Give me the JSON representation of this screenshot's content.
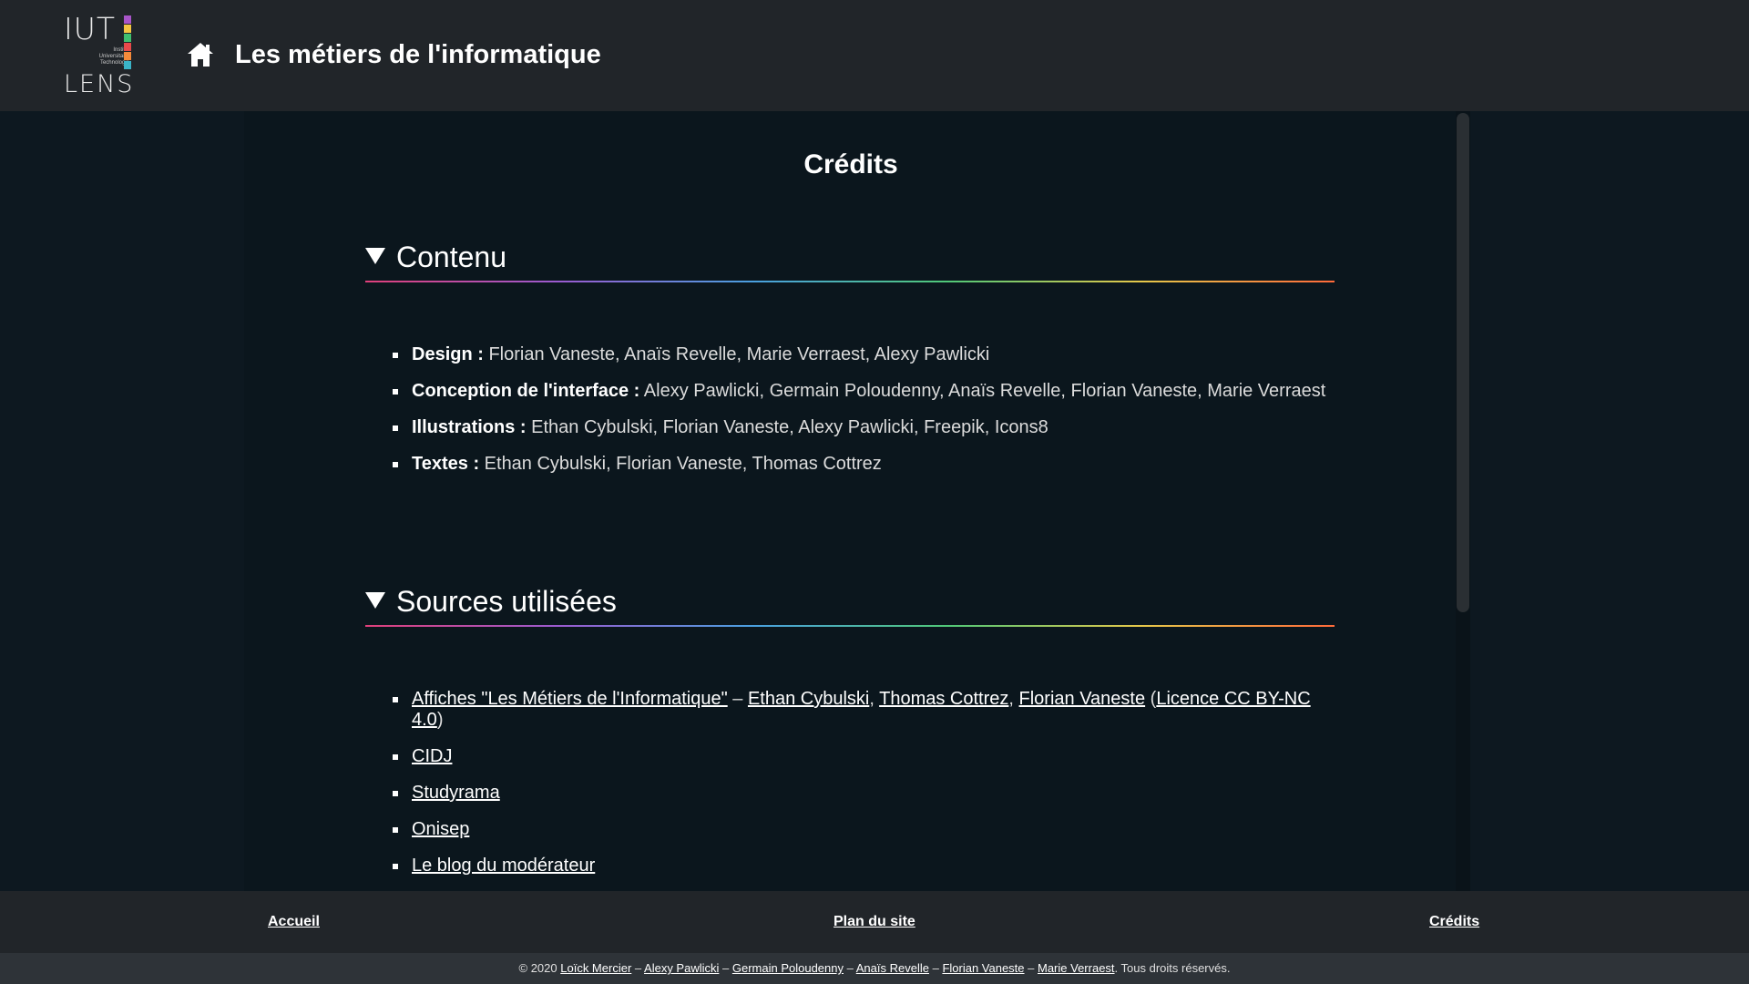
{
  "header": {
    "logo": {
      "top": "IUT",
      "sub": [
        "Institut",
        "Universitaire",
        "Technologie"
      ],
      "bottom": "LENS",
      "bar_colors": [
        "#a855c8",
        "#f4c542",
        "#3fbf6f",
        "#e84a4a",
        "#f58a3a",
        "#3ab4c8"
      ]
    },
    "home_icon": "house-icon",
    "title": "Les métiers de l'informatique"
  },
  "main": {
    "title": "Crédits",
    "sections": [
      {
        "summary": "Contenu",
        "items": [
          {
            "label": "Design :",
            "text": " Florian Vaneste, Anaïs Revelle, Marie Verraest, Alexy Pawlicki"
          },
          {
            "label": "Conception de l'interface :",
            "text": " Alexy Pawlicki, Germain Poloudenny, Anaïs Revelle, Florian Vaneste, Marie Verraest"
          },
          {
            "label": "Illustrations :",
            "text": " Ethan Cybulski, Florian Vaneste, Alexy Pawlicki, Freepik, Icons8"
          },
          {
            "label": "Textes :",
            "text": " Ethan Cybulski, Florian Vaneste, Thomas Cottrez"
          }
        ]
      },
      {
        "summary": "Sources utilisées",
        "source_first": {
          "link1": "Affiches \"Les Métiers de l'Informatique\"",
          "sep1": " – ",
          "link2": "Ethan Cybulski",
          "comma1": ", ",
          "link3": "Thomas Cottrez",
          "comma2": ", ",
          "link4": "Florian Vaneste",
          "paren_open": " (",
          "link5": "Licence CC BY-NC 4.0",
          "paren_close": ")"
        },
        "links": [
          "CIDJ",
          "Studyrama",
          "Onisep",
          "Le blog du modérateur"
        ]
      }
    ]
  },
  "footer": {
    "nav": [
      "Accueil",
      "Plan du site",
      "Crédits"
    ],
    "copy": {
      "prefix": "© 2020 ",
      "authors": [
        "Loïck Mercier",
        "Alexy Pawlicki",
        "Germain Poloudenny",
        "Anaïs Revelle",
        "Florian Vaneste",
        "Marie Verraest"
      ],
      "separator": " – ",
      "suffix": ". Tous droits réservés."
    }
  }
}
